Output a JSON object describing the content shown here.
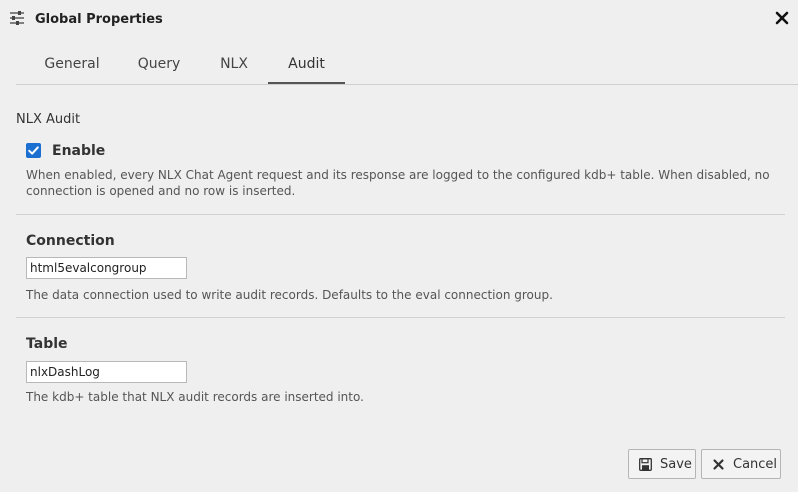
{
  "dialog": {
    "title": "Global Properties",
    "title_icon": "sliders-icon",
    "close_icon": "close-icon"
  },
  "tabs": [
    {
      "label": "General",
      "active": false
    },
    {
      "label": "Query",
      "active": false
    },
    {
      "label": "NLX",
      "active": false
    },
    {
      "label": "Audit",
      "active": true
    }
  ],
  "audit": {
    "heading": "NLX Audit",
    "enable": {
      "label": "Enable",
      "checked": true,
      "description": "When enabled, every NLX Chat Agent request and its response are logged to the configured kdb+ table. When disabled, no connection is opened and no row is inserted."
    },
    "connection": {
      "label": "Connection",
      "value": "html5evalcongroup",
      "description": "The data connection used to write audit records. Defaults to the eval connection group."
    },
    "table": {
      "label": "Table",
      "value": "nlxDashLog",
      "description": "The kdb+ table that NLX audit records are inserted into."
    }
  },
  "buttons": {
    "save": {
      "label": "Save",
      "icon": "save-icon"
    },
    "cancel": {
      "label": "Cancel",
      "icon": "close-icon"
    }
  },
  "colors": {
    "checkbox": "#1a6fd0",
    "background": "#efefef"
  }
}
